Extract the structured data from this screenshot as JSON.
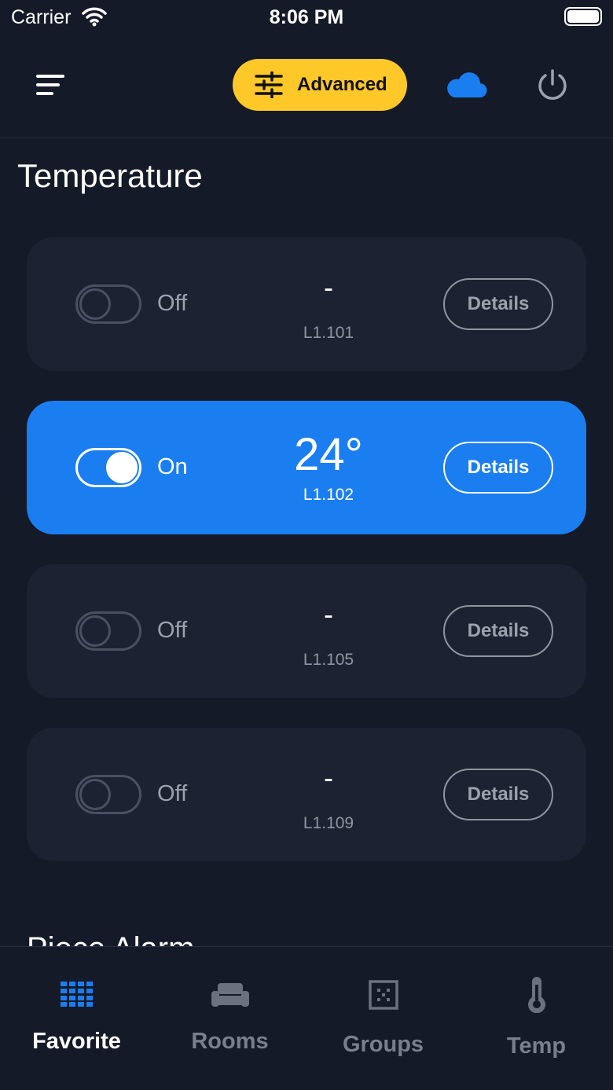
{
  "status_bar": {
    "carrier": "Carrier",
    "time": "8:06 PM"
  },
  "top_nav": {
    "advanced_label": "Advanced"
  },
  "page_title": "Temperature",
  "cards": [
    {
      "toggle_label": "Off",
      "value": "-",
      "id": "L1.101",
      "details_label": "Details",
      "on": false
    },
    {
      "toggle_label": "On",
      "value": "24°",
      "id": "L1.102",
      "details_label": "Details",
      "on": true
    },
    {
      "toggle_label": "Off",
      "value": "-",
      "id": "L1.105",
      "details_label": "Details",
      "on": false
    },
    {
      "toggle_label": "Off",
      "value": "-",
      "id": "L1.109",
      "details_label": "Details",
      "on": false
    }
  ],
  "next_section": "Piece Alarm",
  "tabs": [
    {
      "label": "Favorite",
      "icon": "grid-icon",
      "active": true
    },
    {
      "label": "Rooms",
      "icon": "sofa-icon",
      "active": false
    },
    {
      "label": "Groups",
      "icon": "groups-icon",
      "active": false
    },
    {
      "label": "Temp",
      "icon": "thermometer-icon",
      "active": false
    }
  ],
  "colors": {
    "background": "#151a28",
    "card": "#1d2232",
    "accent_blue": "#1a7ef0",
    "accent_yellow": "#ffc829"
  }
}
